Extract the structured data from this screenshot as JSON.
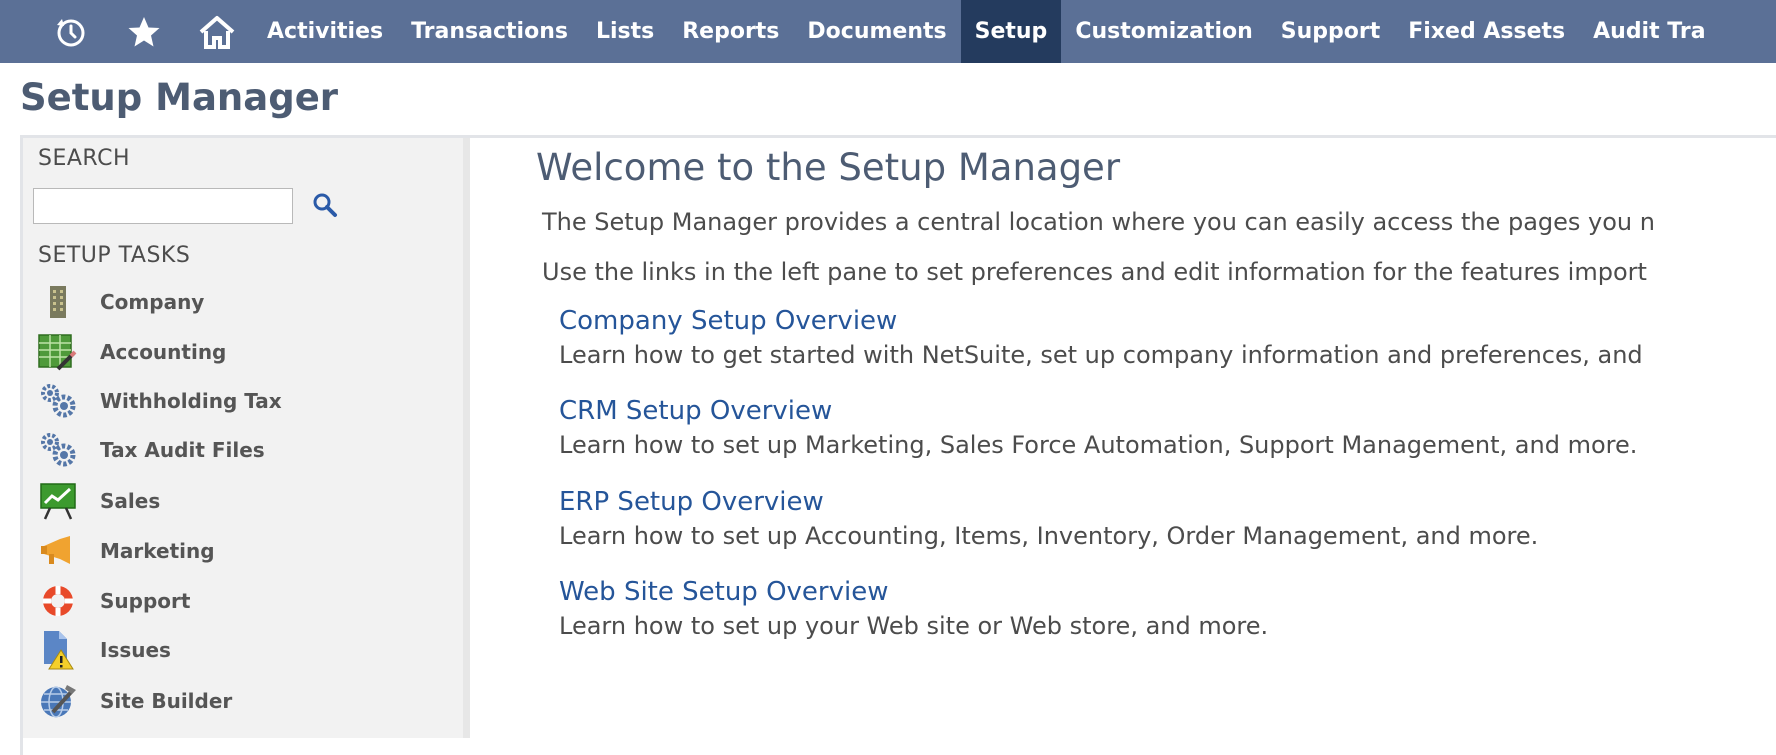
{
  "nav": {
    "icons": [
      {
        "name": "recent-icon"
      },
      {
        "name": "star-icon"
      },
      {
        "name": "home-icon"
      }
    ],
    "items": [
      {
        "label": "Activities"
      },
      {
        "label": "Transactions"
      },
      {
        "label": "Lists"
      },
      {
        "label": "Reports"
      },
      {
        "label": "Documents"
      },
      {
        "label": "Setup",
        "active": true
      },
      {
        "label": "Customization"
      },
      {
        "label": "Support"
      },
      {
        "label": "Fixed Assets"
      },
      {
        "label": "Audit Tra"
      }
    ],
    "bg_color": "#5b7096",
    "active_color": "#243b5e"
  },
  "page": {
    "title": "Setup Manager"
  },
  "left": {
    "search_label": "SEARCH",
    "search": {
      "value": "",
      "placeholder": ""
    },
    "tasks_label": "SETUP TASKS",
    "tasks": [
      {
        "label": "Company",
        "icon": "building-icon"
      },
      {
        "label": "Accounting",
        "icon": "ledger-icon"
      },
      {
        "label": "Withholding Tax",
        "icon": "gears-icon"
      },
      {
        "label": "Tax Audit Files",
        "icon": "gears-icon"
      },
      {
        "label": "Sales",
        "icon": "chart-board-icon"
      },
      {
        "label": "Marketing",
        "icon": "megaphone-icon"
      },
      {
        "label": "Support",
        "icon": "lifebuoy-icon"
      },
      {
        "label": "Issues",
        "icon": "warning-document-icon"
      },
      {
        "label": "Site Builder",
        "icon": "globe-tool-icon"
      }
    ]
  },
  "main": {
    "welcome": "Welcome to the Setup Manager",
    "intro1": "The Setup Manager provides a central location where you can easily access the pages you n",
    "intro2": "Use the links in the left pane to set preferences and edit information for the features import",
    "overviews": [
      {
        "title": "Company Setup Overview",
        "desc": "Learn how to get started with NetSuite, set up company information and preferences, and"
      },
      {
        "title": "CRM Setup Overview",
        "desc": "Learn how to set up Marketing, Sales Force Automation, Support Management, and more."
      },
      {
        "title": "ERP Setup Overview",
        "desc": "Learn how to set up Accounting, Items, Inventory, Order Management, and more."
      },
      {
        "title": "Web Site Setup Overview",
        "desc": "Learn how to set up your Web site or Web store, and more."
      }
    ],
    "link_color": "#255599"
  }
}
